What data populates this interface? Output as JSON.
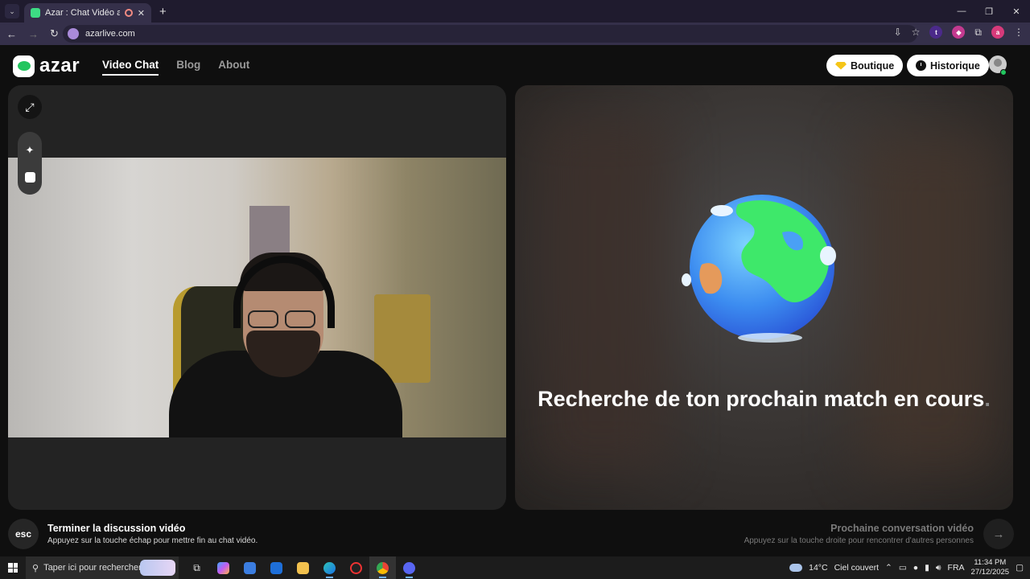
{
  "browser": {
    "tab_title": "Azar : Chat Vidéo avec de n",
    "url": "azarlive.com",
    "new_tab": "+",
    "ext_letters": [
      "t",
      "a"
    ]
  },
  "nav": {
    "logo_text": "azar",
    "links": [
      "Video Chat",
      "Blog",
      "About"
    ],
    "shop_label": "Boutique",
    "history_label": "Historique"
  },
  "match": {
    "status_text": "Recherche de ton prochain match en cours",
    "dots": "."
  },
  "footer": {
    "esc_label": "esc",
    "end_title": "Terminer la discussion vidéo",
    "end_hint": "Appuyez sur la touche échap pour mettre fin au chat vidéo.",
    "next_title": "Prochaine conversation vidéo",
    "next_hint": "Appuyez sur la touche droite pour rencontrer d'autres personnes"
  },
  "taskbar": {
    "search_placeholder": "Taper ici pour rechercher",
    "weather": "14°C",
    "weather_desc": "Ciel couvert",
    "lang": "FRA",
    "time": "11:34 PM",
    "date": "27/12/2025"
  },
  "colors": {
    "accent_green": "#22c55e",
    "gem_yellow": "#f5c518"
  }
}
